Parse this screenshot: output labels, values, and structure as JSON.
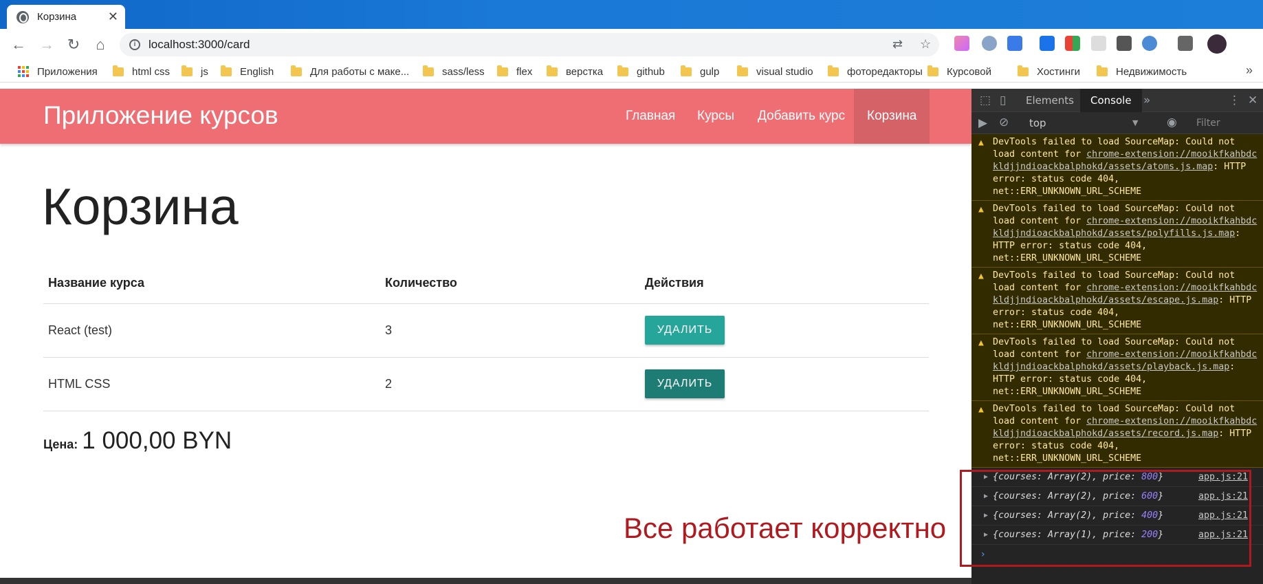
{
  "browser": {
    "tab_title": "Корзина",
    "tab_close": "✕",
    "url": "localhost:3000/card",
    "nav": {
      "back": "←",
      "forward": "→",
      "reload": "↻",
      "home": "⌂"
    },
    "omnibox_icons": {
      "translate": "⇄",
      "star": "☆"
    },
    "bookmarks_overflow": "»",
    "bookmarks": [
      {
        "label": "Приложения",
        "icon": "apps-grid-icon"
      },
      {
        "label": "html css",
        "icon": "folder-icon"
      },
      {
        "label": "js",
        "icon": "folder-icon"
      },
      {
        "label": "English",
        "icon": "folder-icon"
      },
      {
        "label": "Для работы с маке...",
        "icon": "folder-icon"
      },
      {
        "label": "sass/less",
        "icon": "folder-icon"
      },
      {
        "label": "flex",
        "icon": "folder-icon"
      },
      {
        "label": "верстка",
        "icon": "folder-icon"
      },
      {
        "label": "github",
        "icon": "folder-icon"
      },
      {
        "label": "gulp",
        "icon": "folder-icon"
      },
      {
        "label": "visual studio",
        "icon": "folder-icon"
      },
      {
        "label": "фоторедакторы",
        "icon": "folder-icon"
      },
      {
        "label": "Курсовой",
        "icon": "folder-icon"
      },
      {
        "label": "Хостинги",
        "icon": "folder-icon"
      },
      {
        "label": "Недвижимость",
        "icon": "folder-icon"
      }
    ]
  },
  "app": {
    "brand": "Приложение курсов",
    "nav": [
      {
        "label": "Главная",
        "active": false
      },
      {
        "label": "Курсы",
        "active": false
      },
      {
        "label": "Добавить курс",
        "active": false
      },
      {
        "label": "Корзина",
        "active": true
      }
    ],
    "page_title": "Корзина",
    "table": {
      "headers": [
        "Название курса",
        "Количество",
        "Действия"
      ],
      "rows": [
        {
          "name": "React (test)",
          "qty": "3",
          "action": "УДАЛИТЬ"
        },
        {
          "name": "HTML CSS",
          "qty": "2",
          "action": "УДАЛИТЬ"
        }
      ]
    },
    "price_label": "Цена:",
    "price_value": "1 000,00 BYN"
  },
  "annotation": "Все работает корректно",
  "devtools": {
    "icons": {
      "inspect": "⬚",
      "device": "▯",
      "more_tabs": "»",
      "menu": "⋮",
      "close": "✕",
      "sidebar": "▶",
      "clear": "⊘",
      "eye": "◉",
      "ctx_caret": "▼"
    },
    "tabs": [
      {
        "label": "Elements",
        "active": false
      },
      {
        "label": "Console",
        "active": true
      }
    ],
    "context": "top",
    "filter_placeholder": "Filter",
    "warnings": [
      {
        "pre": "DevTools failed to load SourceMap: Could not load content for ",
        "link": "chrome-extension://mooikfkahbdckldjjndioackbalphokd/assets/atoms.js.map",
        "post": ": HTTP error: status code 404, net::ERR_UNKNOWN_URL_SCHEME"
      },
      {
        "pre": "DevTools failed to load SourceMap: Could not load content for ",
        "link": "chrome-extension://mooikfkahbdckldjjndioackbalphokd/assets/polyfills.js.map",
        "post": ": HTTP error: status code 404, net::ERR_UNKNOWN_URL_SCHEME"
      },
      {
        "pre": "DevTools failed to load SourceMap: Could not load content for ",
        "link": "chrome-extension://mooikfkahbdckldjjndioackbalphokd/assets/escape.js.map",
        "post": ": HTTP error: status code 404, net::ERR_UNKNOWN_URL_SCHEME"
      },
      {
        "pre": "DevTools failed to load SourceMap: Could not load content for ",
        "link": "chrome-extension://mooikfkahbdckldjjndioackbalphokd/assets/playback.js.map",
        "post": ": HTTP error: status code 404, net::ERR_UNKNOWN_URL_SCHEME"
      },
      {
        "pre": "DevTools failed to load SourceMap: Could not load content for ",
        "link": "chrome-extension://mooikfkahbdckldjjndioackbalphokd/assets/record.js.map",
        "post": ": HTTP error: status code 404, net::ERR_UNKNOWN_URL_SCHEME"
      }
    ],
    "logs": [
      {
        "text": "{courses: Array(2), price: ",
        "num": "800",
        "end": "}",
        "src": "app.js:21"
      },
      {
        "text": "{courses: Array(2), price: ",
        "num": "600",
        "end": "}",
        "src": "app.js:21"
      },
      {
        "text": "{courses: Array(2), price: ",
        "num": "400",
        "end": "}",
        "src": "app.js:21"
      },
      {
        "text": "{courses: Array(1), price: ",
        "num": "200",
        "end": "}",
        "src": "app.js:21"
      }
    ],
    "prompt": "›"
  }
}
